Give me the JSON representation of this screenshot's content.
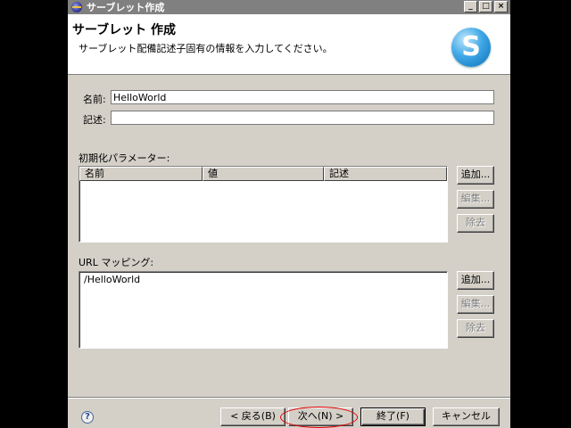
{
  "window": {
    "title": "サーブレット作成",
    "controls": {
      "minimize": "_",
      "maximize": "□",
      "close": "×"
    }
  },
  "banner": {
    "title": "サーブレット 作成",
    "description": "サーブレット配備記述子固有の情報を入力してください。",
    "logo_letter": "S"
  },
  "form": {
    "name_label": "名前:",
    "name_value": "HelloWorld",
    "description_label": "記述:",
    "description_value": ""
  },
  "init_params": {
    "label": "初期化パラメーター:",
    "columns": [
      "名前",
      "値",
      "記述"
    ],
    "rows": [],
    "buttons": {
      "add": "追加...",
      "edit": "編集...",
      "remove": "除去"
    }
  },
  "url_mappings": {
    "label": "URL マッピング:",
    "items": [
      "/HelloWorld"
    ],
    "buttons": {
      "add": "追加...",
      "edit": "編集...",
      "remove": "除去"
    }
  },
  "footer": {
    "help": "?",
    "back": "< 戻る(B)",
    "next": "次へ(N) >",
    "finish": "終了(F)",
    "cancel": "キャンセル"
  },
  "colors": {
    "highlight_ring": "#e00000",
    "dialog_bg": "#d4d0c8"
  }
}
